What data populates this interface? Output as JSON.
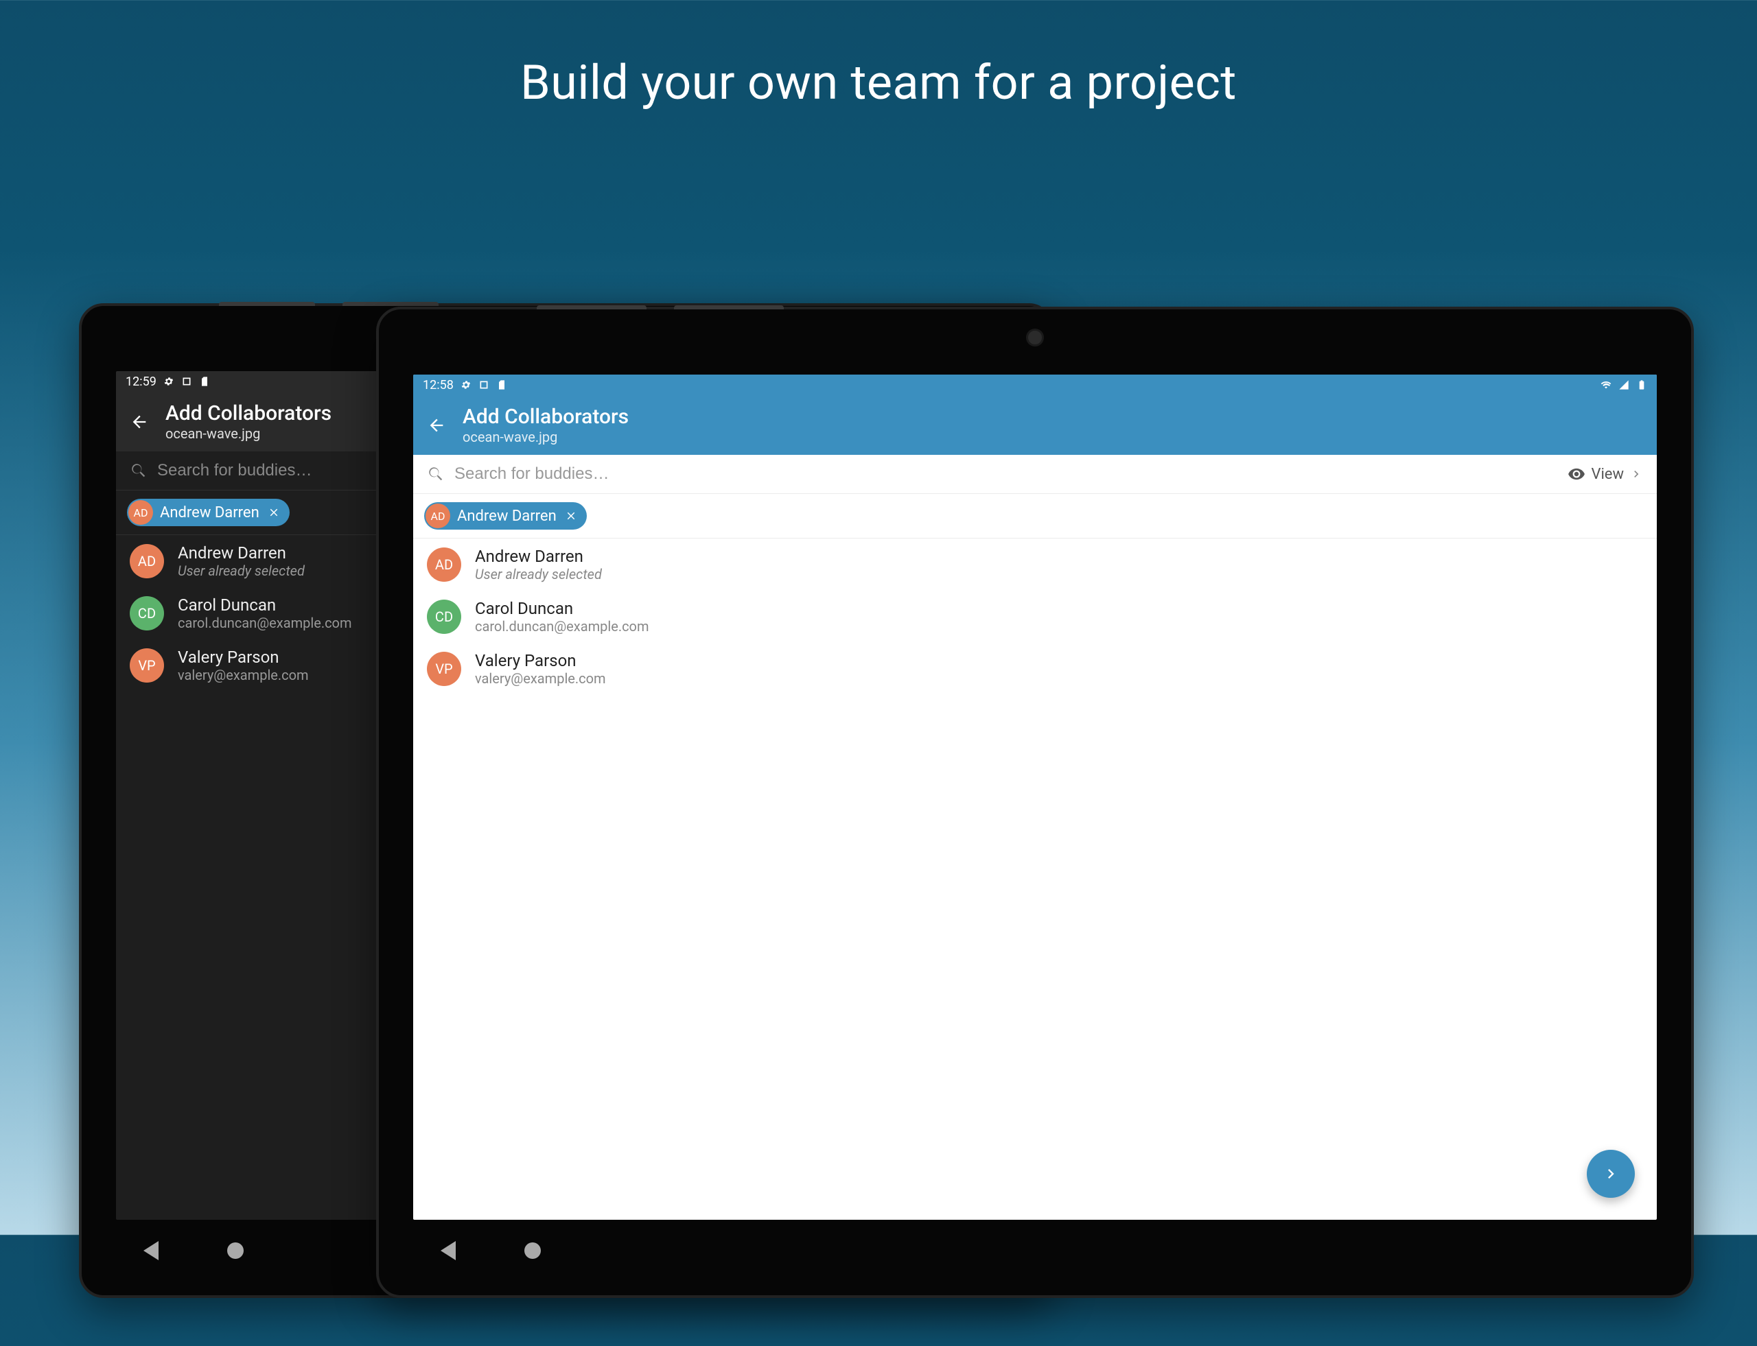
{
  "title": "Build your own team for a project",
  "back": {
    "time": "12:59",
    "appbar_title": "Add Collaborators",
    "appbar_subtitle": "ocean-wave.jpg",
    "search_placeholder": "Search for buddies…",
    "chip_label": "Andrew Darren",
    "chip_initials": "AD",
    "users": [
      {
        "initials": "AD",
        "name": "Andrew Darren",
        "sub": "User already selected",
        "italic": true,
        "av": "av-ad"
      },
      {
        "initials": "CD",
        "name": "Carol Duncan",
        "sub": "carol.duncan@example.com",
        "italic": false,
        "av": "av-cd"
      },
      {
        "initials": "VP",
        "name": "Valery Parson",
        "sub": "valery@example.com",
        "italic": false,
        "av": "av-vp"
      }
    ]
  },
  "front": {
    "time": "12:58",
    "appbar_title": "Add Collaborators",
    "appbar_subtitle": "ocean-wave.jpg",
    "search_placeholder": "Search for buddies…",
    "view_label": "View",
    "chip_label": "Andrew Darren",
    "chip_initials": "AD",
    "users": [
      {
        "initials": "AD",
        "name": "Andrew Darren",
        "sub": "User already selected",
        "italic": true,
        "av": "av-ad"
      },
      {
        "initials": "CD",
        "name": "Carol Duncan",
        "sub": "carol.duncan@example.com",
        "italic": false,
        "av": "av-cd"
      },
      {
        "initials": "VP",
        "name": "Valery Parson",
        "sub": "valery@example.com",
        "italic": false,
        "av": "av-vp"
      }
    ]
  }
}
